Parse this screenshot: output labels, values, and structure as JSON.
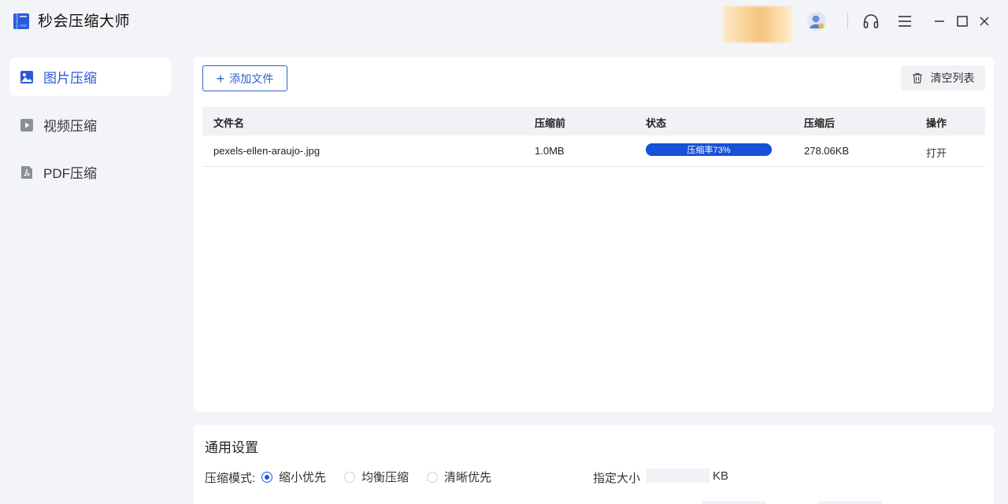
{
  "app": {
    "title": "秒会压缩大师",
    "accent_color": "#1a56db"
  },
  "titlebar_icons": [
    "headset-icon",
    "menu-icon",
    "minimize-icon",
    "maximize-icon",
    "close-icon"
  ],
  "sidebar": {
    "items": [
      {
        "label": "图片压缩",
        "icon": "image-icon",
        "active": true
      },
      {
        "label": "视频压缩",
        "icon": "video-icon",
        "active": false
      },
      {
        "label": "PDF压缩",
        "icon": "pdf-icon",
        "active": false
      }
    ]
  },
  "toolbar": {
    "add_label": "添加文件",
    "clear_label": "清空列表"
  },
  "table": {
    "columns": [
      "文件名",
      "压缩前",
      "状态",
      "压缩后",
      "操作"
    ],
    "rows": [
      {
        "filename": "pexels-ellen-araujo-.jpg",
        "size_before": "1.0MB",
        "status": "压缩率73%",
        "progress_percent": 100,
        "size_after": "278.06KB",
        "action": "打开"
      }
    ]
  },
  "settings": {
    "title": "通用设置",
    "mode_label": "压缩模式:",
    "modes": [
      {
        "label": "缩小优先",
        "checked": true
      },
      {
        "label": "均衡压缩",
        "checked": false
      },
      {
        "label": "清晰优先",
        "checked": false
      }
    ],
    "size_label": "指定大小",
    "size_value": "",
    "size_unit": "KB"
  }
}
